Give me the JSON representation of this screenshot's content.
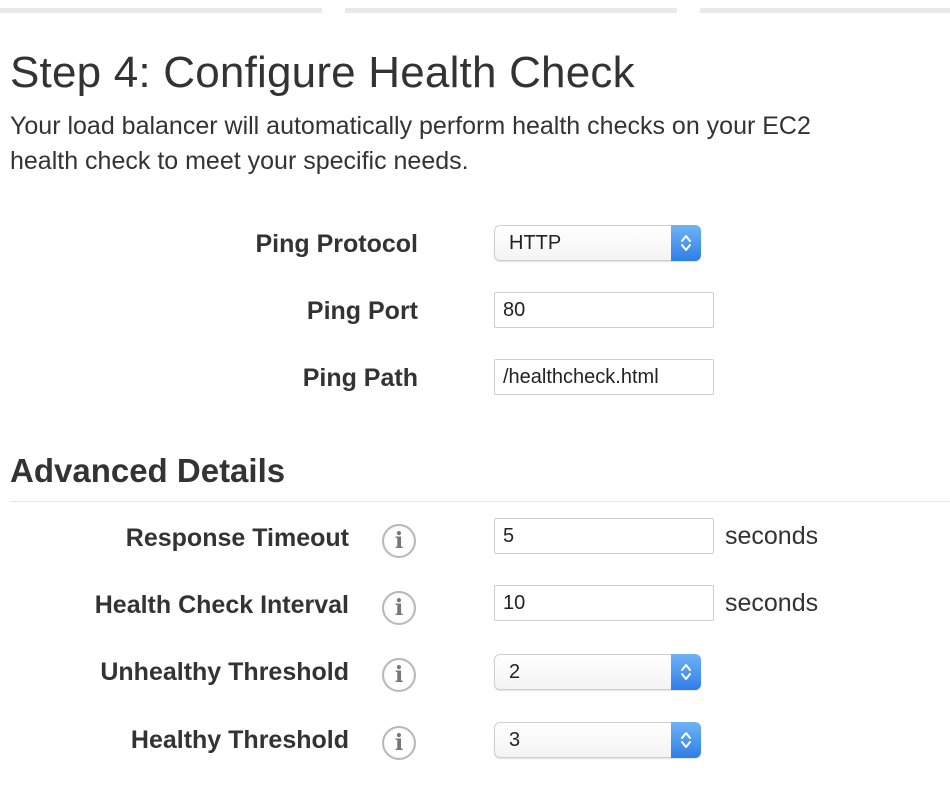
{
  "page": {
    "title": "Step 4: Configure Health Check",
    "intro_line1": "Your load balancer will automatically perform health checks on your EC2",
    "intro_line2": "health check to meet your specific needs."
  },
  "health_check": {
    "ping_protocol": {
      "label": "Ping Protocol",
      "value": "HTTP"
    },
    "ping_port": {
      "label": "Ping Port",
      "value": "80"
    },
    "ping_path": {
      "label": "Ping Path",
      "value": "/healthcheck.html"
    }
  },
  "advanced": {
    "title": "Advanced Details",
    "response_timeout": {
      "label": "Response Timeout",
      "value": "5",
      "unit": "seconds"
    },
    "health_check_interval": {
      "label": "Health Check Interval",
      "value": "10",
      "unit": "seconds"
    },
    "unhealthy_threshold": {
      "label": "Unhealthy Threshold",
      "value": "2"
    },
    "healthy_threshold": {
      "label": "Healthy Threshold",
      "value": "3"
    }
  },
  "icons": {
    "info": "info-icon",
    "stepper": "chevron-up-down-icon"
  },
  "colors": {
    "accent": "#3b86ec",
    "text": "#333333"
  }
}
